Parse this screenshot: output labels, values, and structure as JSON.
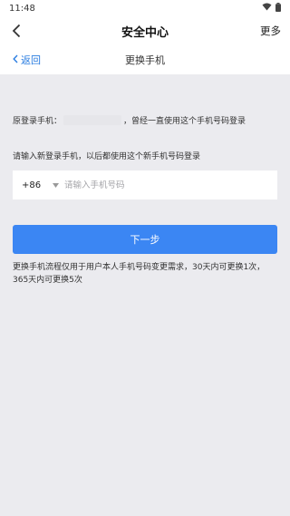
{
  "status_bar": {
    "time": "11:48",
    "icons": [
      "wifi-icon",
      "battery-icon"
    ]
  },
  "header": {
    "back_icon": "chevron-left-icon",
    "title": "安全中心",
    "more_label": "更多"
  },
  "sub_header": {
    "back_icon": "chevron-left-icon",
    "back_label": "返回",
    "title": "更换手机"
  },
  "form": {
    "original_prefix": "原登录手机：",
    "original_suffix": "，曾经一直使用这个手机号码登录",
    "new_phone_hint": "请输入新登录手机，以后都使用这个新手机号码登录",
    "country_code": "+86",
    "dropdown_icon": "caret-down-icon",
    "phone_value": "",
    "phone_placeholder": "请输入手机号码",
    "next_button_label": "下一步",
    "notice": "更换手机流程仅用于用户本人手机号码变更需求，30天内可更换1次，365天内可更换5次"
  },
  "colors": {
    "accent": "#3b86f3",
    "link": "#2a7de1",
    "background": "#ebebef"
  }
}
